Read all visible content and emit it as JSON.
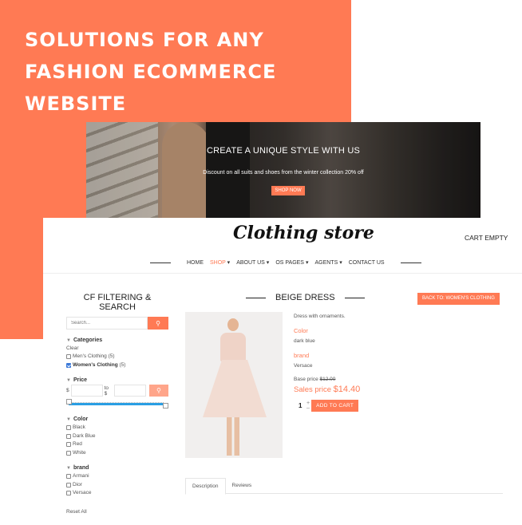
{
  "promo": {
    "headline_lines": [
      "SOLUTIONS FOR ANY",
      "FASHION ECOMMERCE",
      "WEBSITE"
    ],
    "accent_color": "#ff7a54"
  },
  "hero": {
    "title": "CREATE A UNIQUE STYLE WITH US",
    "subtitle": "Discount on all suits and shoes from the winter collection 20% off",
    "cta_label": "SHOP NOW"
  },
  "header": {
    "logo_text": "Clothing store",
    "cart_label": "CART EMPTY",
    "nav": [
      {
        "label": "HOME",
        "active": false,
        "dropdown": false
      },
      {
        "label": "SHOP",
        "active": true,
        "dropdown": true
      },
      {
        "label": "ABOUT US",
        "active": false,
        "dropdown": true
      },
      {
        "label": "OS PAGES",
        "active": false,
        "dropdown": true
      },
      {
        "label": "AGENTS",
        "active": false,
        "dropdown": true
      },
      {
        "label": "CONTACT US",
        "active": false,
        "dropdown": false
      }
    ],
    "dropdown_glyph": "▾"
  },
  "sidebar": {
    "title": "CF FILTERING & SEARCH",
    "search": {
      "placeholder": "Search...",
      "icon": "search-icon"
    },
    "categories": {
      "title": "Categories",
      "clear_label": "Clear",
      "items": [
        {
          "label": "Men's Clothing",
          "count": "(5)",
          "checked": false
        },
        {
          "label": "Women's Clothing",
          "count": "(5)",
          "checked": true
        }
      ]
    },
    "price": {
      "title": "Price",
      "from_prefix": "$",
      "to_prefix": "to $",
      "from_value": "",
      "to_value": "",
      "slider_min_fraction": 0,
      "slider_max_fraction": 1
    },
    "color": {
      "title": "Color",
      "items": [
        {
          "label": "Black",
          "checked": false
        },
        {
          "label": "Dark Blue",
          "checked": false
        },
        {
          "label": "Red",
          "checked": false
        },
        {
          "label": "White",
          "checked": false
        }
      ]
    },
    "brand": {
      "title": "brand",
      "items": [
        {
          "label": "Armani",
          "checked": false
        },
        {
          "label": "Dior",
          "checked": false
        },
        {
          "label": "Versace",
          "checked": false
        }
      ]
    },
    "reset_label": "Reset All"
  },
  "product": {
    "title": "BEIGE DRESS",
    "back_label": "BACK TO: WOMEN'S CLOTHING",
    "description": "Dress with ornaments.",
    "attributes": [
      {
        "label": "Color",
        "value": "dark blue"
      },
      {
        "label": "brand",
        "value": "Versace"
      }
    ],
    "base_price_label": "Base price",
    "base_price": "$12.00",
    "sales_price_label": "Sales price",
    "sales_price": "$14.40",
    "quantity": "1",
    "add_to_cart_label": "ADD TO CART",
    "tabs": [
      {
        "label": "Description",
        "active": true
      },
      {
        "label": "Reviews",
        "active": false
      }
    ]
  }
}
